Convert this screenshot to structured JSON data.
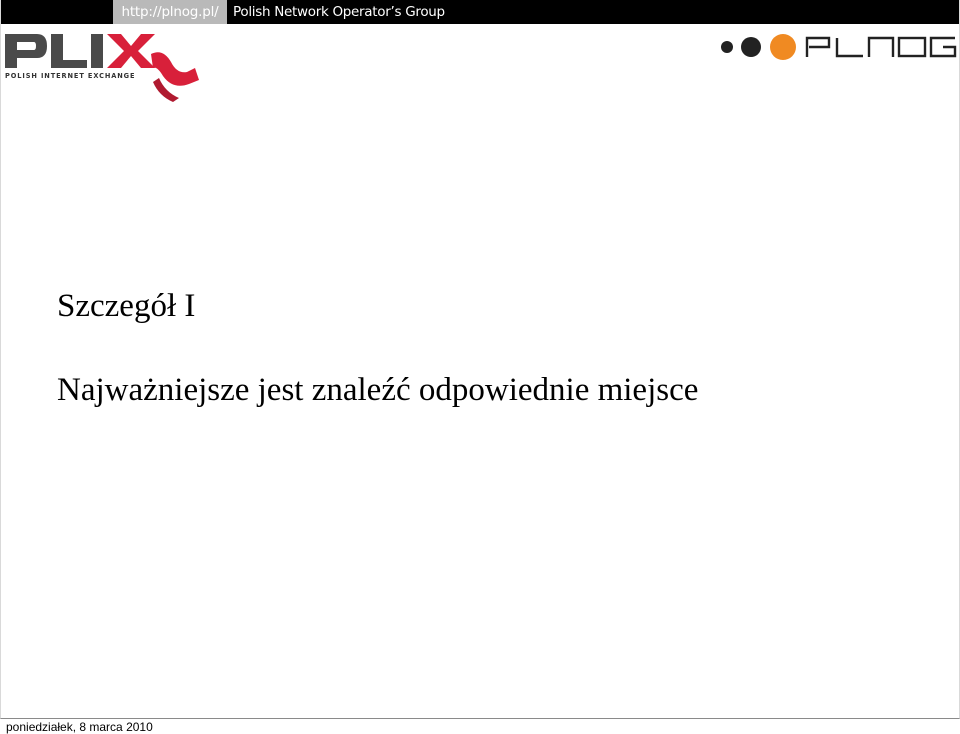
{
  "header": {
    "url": "http://plnog.pl/",
    "group_name": "Polish Network Operator’s Group"
  },
  "logos": {
    "plix_tagline": "POLISH INTERNET EXCHANGE",
    "plix_icon": "plix-logo",
    "plnog_icon": "plnog-logo"
  },
  "slide": {
    "title": "Szczegół I",
    "body": "Najważniejsze jest znaleźć odpowiednie miejsce"
  },
  "footer": {
    "date": "poniedziałek, 8 marca 2010"
  },
  "colors": {
    "topbar": "#000000",
    "url_tab": "#b9b9b9",
    "plix_gray": "#4a4a4a",
    "plix_red": "#d8203a",
    "plnog_orange": "#f08a22",
    "plnog_dark": "#222222"
  }
}
